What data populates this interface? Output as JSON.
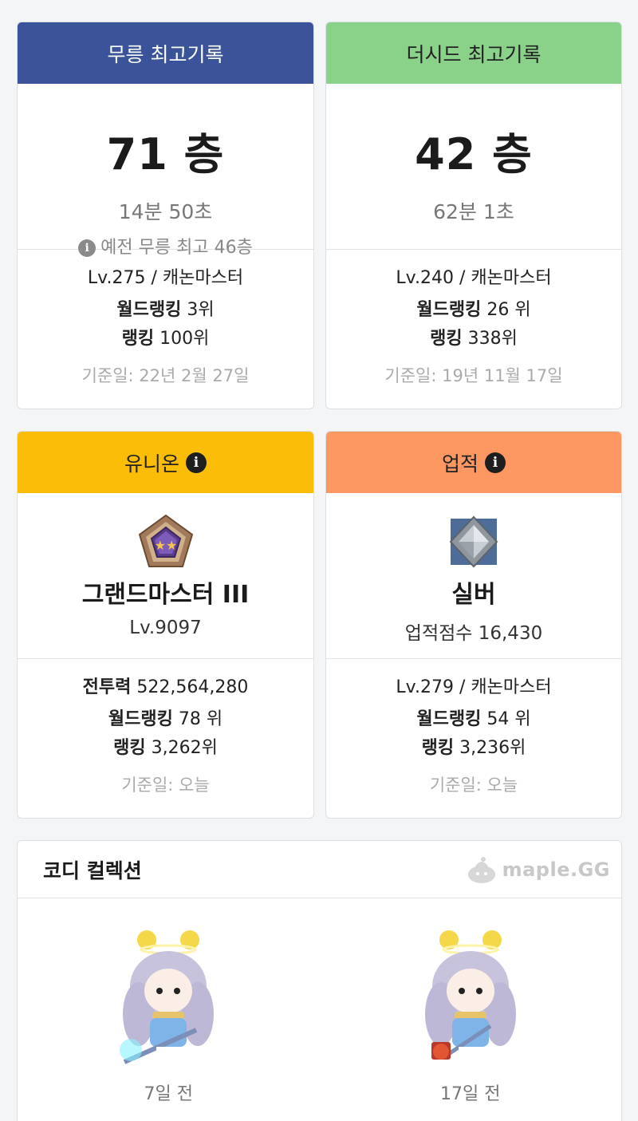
{
  "mureung": {
    "header": "무릉 최고기록",
    "floor": "71 층",
    "time": "14분 50초",
    "previous": "예전 무릉 최고 46층",
    "level_class": "Lv.275 / 캐논마스터",
    "world_rank_label": "월드랭킹",
    "world_rank_value": "3위",
    "rank_label": "랭킹",
    "rank_value": "100위",
    "date": "기준일: 22년 2월 27일"
  },
  "theseed": {
    "header": "더시드 최고기록",
    "floor": "42 층",
    "time": "62분 1초",
    "level_class": "Lv.240 / 캐논마스터",
    "world_rank_label": "월드랭킹",
    "world_rank_value": "26 위",
    "rank_label": "랭킹",
    "rank_value": "338위",
    "date": "기준일: 19년 11월 17일"
  },
  "union": {
    "header": "유니온",
    "grade": "그랜드마스터 III",
    "level": "Lv.9097",
    "power_label": "전투력",
    "power_value": "522,564,280",
    "world_rank_label": "월드랭킹",
    "world_rank_value": "78 위",
    "rank_label": "랭킹",
    "rank_value": "3,262위",
    "date": "기준일: 오늘"
  },
  "achievement": {
    "header": "업적",
    "grade": "실버",
    "score": "업적점수 16,430",
    "level_class": "Lv.279 / 캐논마스터",
    "world_rank_label": "월드랭킹",
    "world_rank_value": "54 위",
    "rank_label": "랭킹",
    "rank_value": "3,236위",
    "date": "기준일: 오늘"
  },
  "coordi": {
    "title": "코디 컬렉션",
    "logo_text": "maple.GG",
    "items": [
      {
        "label": "7일 전"
      },
      {
        "label": "17일 전"
      }
    ]
  },
  "colors": {
    "mureung_header": "#3b5499",
    "theseed_header": "#8ad18a",
    "union_header": "#fbbd08",
    "achievement_header": "#fe9862"
  },
  "icons": [
    "info-icon",
    "union-emblem-icon",
    "achievement-silver-icon",
    "maple-gg-logo-icon"
  ]
}
